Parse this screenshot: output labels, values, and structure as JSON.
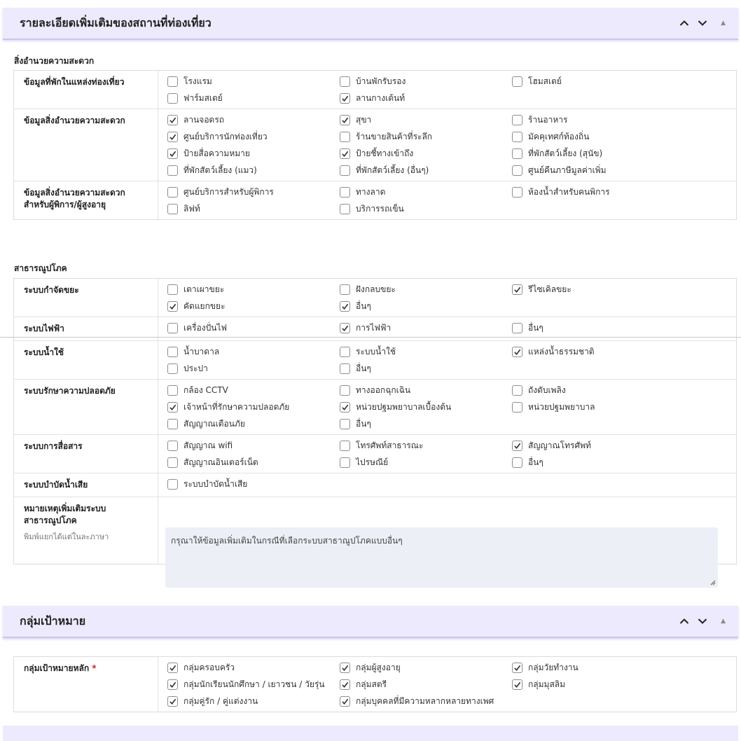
{
  "sections": {
    "details": {
      "title": "รายละเอียดเพิ่มเติมของสถานที่ท่องเที่ยว"
    },
    "target": {
      "title": "กลุ่มเป้าหมาย"
    }
  },
  "facilities": {
    "heading": "สิ่งอำนวยความสะดวก",
    "rows": [
      {
        "label": "ข้อมูลที่พักในแหล่งท่องเที่ยว",
        "options": [
          {
            "label": "โรงแรม",
            "checked": false
          },
          {
            "label": "บ้านพักรับรอง",
            "checked": false
          },
          {
            "label": "โฮมสเตย์",
            "checked": false
          },
          {
            "label": "ฟาร์มสเตย์",
            "checked": false
          },
          {
            "label": "ลานกางเต้นท์",
            "checked": true
          }
        ]
      },
      {
        "label": "ข้อมูลสิ่งอำนวยความสะดวก",
        "options": [
          {
            "label": "ลานจอดรถ",
            "checked": true
          },
          {
            "label": "สุขา",
            "checked": true
          },
          {
            "label": "ร้านอาหาร",
            "checked": false
          },
          {
            "label": "ศูนย์บริการนักท่องเที่ยว",
            "checked": true
          },
          {
            "label": "ร้านขายสินค้าที่ระลึก",
            "checked": false
          },
          {
            "label": "มัคคุเทศก์ท้องถิ่น",
            "checked": false
          },
          {
            "label": "ป้ายสื่อความหมาย",
            "checked": true
          },
          {
            "label": "ป้ายชี้ทางเข้าถึง",
            "checked": true
          },
          {
            "label": "ที่พักสัตว์เลี้ยง (สุนัข)",
            "checked": false
          },
          {
            "label": "ที่พักสัตว์เลี้ยง (แมว)",
            "checked": false
          },
          {
            "label": "ที่พักสัตว์เลี้ยง (อื่นๆ)",
            "checked": false
          },
          {
            "label": "ศูนย์คืนภาษีมูลค่าเพิ่ม",
            "checked": false
          }
        ]
      },
      {
        "label": "ข้อมูลสิ่งอำนวยความสะดวกสำหรับผู้พิการ/ผู้สูงอายุ",
        "options": [
          {
            "label": "ศูนย์บริการสำหรับผู้พิการ",
            "checked": false
          },
          {
            "label": "ทางลาด",
            "checked": false
          },
          {
            "label": "ห้องน้ำสำหรับคนพิการ",
            "checked": false
          },
          {
            "label": "ลิฟท์",
            "checked": false
          },
          {
            "label": "บริการรถเข็น",
            "checked": false
          }
        ]
      }
    ]
  },
  "utilities": {
    "heading": "สาธารณูปโภค",
    "rows": [
      {
        "label": "ระบบกำจัดขยะ",
        "options": [
          {
            "label": "เตาเผาขยะ",
            "checked": false
          },
          {
            "label": "ฝังกลบขยะ",
            "checked": false
          },
          {
            "label": "รีไซเคิลขยะ",
            "checked": true
          },
          {
            "label": "คัดแยกขยะ",
            "checked": true
          },
          {
            "label": "อื่นๆ",
            "checked": true
          }
        ]
      },
      {
        "label": "ระบบไฟฟ้า",
        "options": [
          {
            "label": "เครื่องปั่นไฟ",
            "checked": false
          },
          {
            "label": "การไฟฟ้า",
            "checked": true
          },
          {
            "label": "อื่นๆ",
            "checked": false
          }
        ]
      },
      {
        "label": "ระบบน้ำใช้",
        "options": [
          {
            "label": "น้ำบาดาล",
            "checked": false
          },
          {
            "label": "ระบบน้ำใช้",
            "checked": false
          },
          {
            "label": "แหล่งน้ำธรรมชาติ",
            "checked": true
          },
          {
            "label": "ประปา",
            "checked": false
          },
          {
            "label": "อื่นๆ",
            "checked": false
          }
        ]
      },
      {
        "label": "ระบบรักษาความปลอดภัย",
        "options": [
          {
            "label": "กล้อง CCTV",
            "checked": false
          },
          {
            "label": "ทางออกฉุกเฉิน",
            "checked": false
          },
          {
            "label": "ถังดับเพลิง",
            "checked": false
          },
          {
            "label": "เจ้าหน้าที่รักษาความปลอดภัย",
            "checked": true
          },
          {
            "label": "หน่วยปฐมพยาบาลเบื้องต้น",
            "checked": true
          },
          {
            "label": "หน่วยปฐมพยาบาล",
            "checked": false
          },
          {
            "label": "สัญญาณเตือนภัย",
            "checked": false
          },
          {
            "label": "อื่นๆ",
            "checked": false
          }
        ]
      },
      {
        "label": "ระบบการสื่อสาร",
        "options": [
          {
            "label": "สัญญาณ wifi",
            "checked": false
          },
          {
            "label": "โทรศัพท์สาธารณะ",
            "checked": false
          },
          {
            "label": "สัญญาณโทรศัพท์",
            "checked": true
          },
          {
            "label": "สัญญาณอินเตอร์เน็ต",
            "checked": false
          },
          {
            "label": "ไปรษณีย์",
            "checked": false
          },
          {
            "label": "อื่นๆ",
            "checked": false
          }
        ]
      },
      {
        "label": "ระบบบำบัดน้ำเสีย",
        "options": [
          {
            "label": "ระบบบำบัดน้ำเสีย",
            "checked": false
          }
        ]
      }
    ],
    "notes": {
      "label": "หมายเหตุเพิ่มเติมระบบสาธารณูปโภค",
      "hint": "พิมพ์แยกได้แต่ในละภาษา",
      "placeholder": "กรุณาให้ข้อมูลเพิ่มเติมในกรณีที่เลือกระบบสาธาณูปโภคแบบอื่นๆ"
    }
  },
  "targets": {
    "rows": [
      {
        "label": "กลุ่มเป้าหมายหลัก",
        "required_mark": "*",
        "options": [
          {
            "label": "กลุ่มครอบครัว",
            "checked": true
          },
          {
            "label": "กลุ่มผู้สูงอายุ",
            "checked": true
          },
          {
            "label": "กลุ่มวัยทำงาน",
            "checked": true
          },
          {
            "label": "กลุ่มนักเรียนนักศึกษา / เยาวชน / วัยรุ่น",
            "checked": true
          },
          {
            "label": "กลุ่มสตรี",
            "checked": true
          },
          {
            "label": "กลุ่มมุสลิม",
            "checked": true
          },
          {
            "label": "กลุ่มคู่รัก / คู่แต่งงาน",
            "checked": true
          },
          {
            "label": "กลุ่มบุคคลที่มีความหลากหลายทางเพศ",
            "checked": true
          }
        ]
      }
    ]
  },
  "icons": {
    "move_up": "chevron-up-icon",
    "move_down": "chevron-down-icon",
    "collapse": "caret-up-icon",
    "check": "check-icon"
  },
  "colors": {
    "section_header_bg": "#eceafc",
    "section_header_border": "#c9c4f2",
    "textarea_bg": "#eceff6",
    "required": "#d21f1f"
  }
}
